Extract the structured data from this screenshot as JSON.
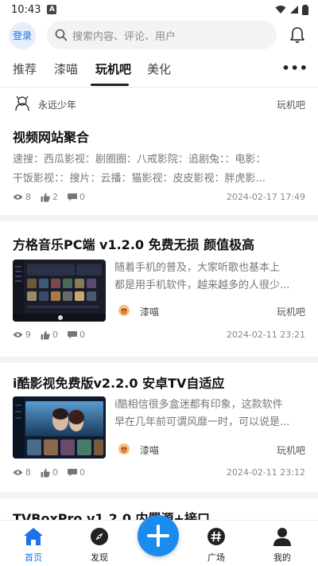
{
  "status_bar": {
    "time": "10:43",
    "badge": "A"
  },
  "header": {
    "login_label": "登录",
    "search_placeholder": "搜索内容、评论、用户"
  },
  "tabs": [
    {
      "label": "推荐"
    },
    {
      "label": "漆喵"
    },
    {
      "label": "玩机吧",
      "active": true
    },
    {
      "label": "美化"
    }
  ],
  "posts": [
    {
      "author": "永远少年",
      "board": "玩机吧",
      "title": "视频网站聚合",
      "excerpt_line1": "速搜：西瓜影视：剧圈圈：八戒影院：追剧兔：：电影：",
      "excerpt_line2": "干饭影视：：搜片：云播：猫影视：皮皮影视：胖虎影...",
      "views": "8",
      "likes": "2",
      "comments": "0",
      "date": "2024-02-17 17:49"
    },
    {
      "title": "方格音乐PC端 v1.2.0 免费无损 颜值极高",
      "excerpt_line1": "随着手机的普及，大家听歌也基本上",
      "excerpt_line2": "都是用手机软件，越来越多的人很少...",
      "author": "漆喵",
      "board": "玩机吧",
      "views": "9",
      "likes": "0",
      "comments": "0",
      "date": "2024-02-11 23:21"
    },
    {
      "title": "i酷影视免费版v2.2.0 安卓TV自适应",
      "excerpt_line1": "i酷相信很多盒迷都有印象，这款软件",
      "excerpt_line2": "早在几年前可谓风靡一时，可以说是...",
      "author": "漆喵",
      "board": "玩机吧",
      "views": "8",
      "likes": "0",
      "comments": "0",
      "date": "2024-02-11 23:12"
    },
    {
      "title": "TVBoxPro v1.2.0 内置源+接口"
    }
  ],
  "bottom_nav": [
    {
      "label": "首页",
      "icon": "home-icon",
      "active": true
    },
    {
      "label": "发现",
      "icon": "compass-icon"
    },
    {
      "label": "广场",
      "icon": "hashtag-icon"
    },
    {
      "label": "我的",
      "icon": "user-icon"
    }
  ],
  "colors": {
    "accent": "#1a73e8",
    "fab": "#1a8cf0"
  }
}
